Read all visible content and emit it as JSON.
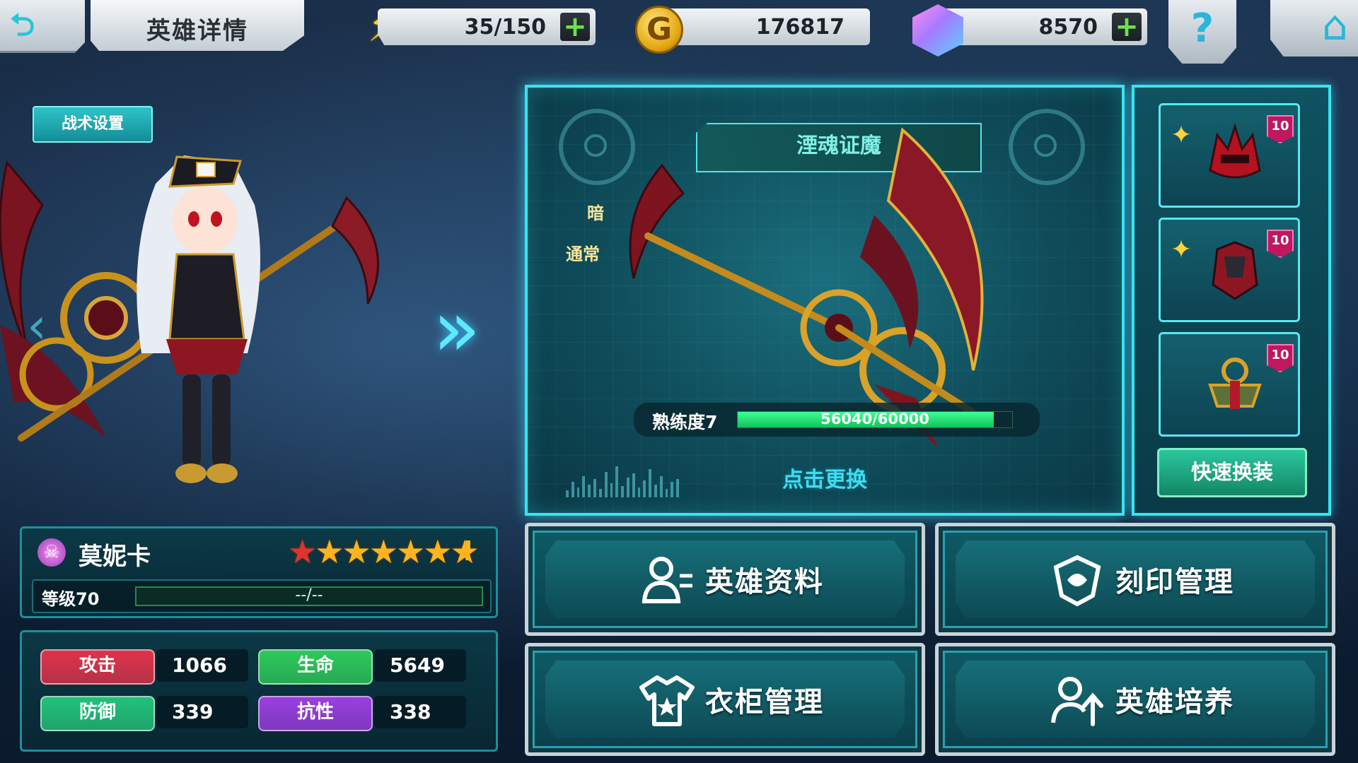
{
  "header": {
    "title": "英雄详情",
    "energy": "35/150",
    "gold": "176817",
    "gold_symbol": "G",
    "gems": "8570",
    "plus_symbol": "+",
    "help_symbol": "?"
  },
  "hero": {
    "tactic_button": "战术设置",
    "name": "莫妮卡",
    "stars": 7,
    "star_glyph": "★",
    "warning": "!",
    "level_label": "等级70",
    "exp_text": "--/--",
    "stats": [
      {
        "label": "攻击",
        "value": "1066",
        "color": "#e0334a"
      },
      {
        "label": "生命",
        "value": "5649",
        "color": "#2fc95a"
      },
      {
        "label": "防御",
        "value": "339",
        "color": "#23c27a"
      },
      {
        "label": "抗性",
        "value": "338",
        "color": "#9b3ee0"
      }
    ]
  },
  "weapon": {
    "name": "湮魂证魔",
    "element_1": "暗",
    "element_2": "通常",
    "proficiency_label": "熟练度7",
    "proficiency_text": "56040/60000",
    "proficiency_fraction": 0.934,
    "change_label": "点击更换"
  },
  "equipment": {
    "slots": [
      {
        "level": "10",
        "item_icon": "red-helmet-icon"
      },
      {
        "level": "10",
        "item_icon": "red-armor-icon"
      },
      {
        "level": "10",
        "item_icon": "gold-emblem-icon"
      }
    ],
    "star_glyph": "✦",
    "quick_equip": "快速换装"
  },
  "menu": {
    "hero_info": "英雄资料",
    "imprint": "刻印管理",
    "wardrobe": "衣柜管理",
    "training": "英雄培养"
  },
  "colors": {
    "accent": "#37e4f0",
    "progress": "#2ee27a"
  }
}
